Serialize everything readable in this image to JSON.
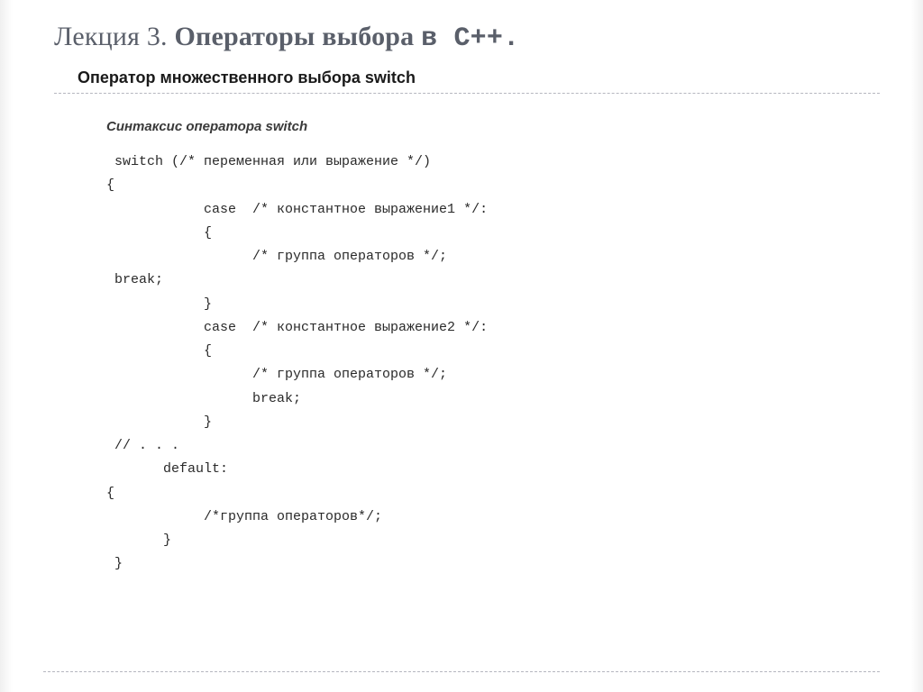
{
  "title": {
    "prefix": "Лекция 3. ",
    "bold": "Операторы выбора ",
    "mono": "в С++."
  },
  "subtitle": "Оператор множественного выбора switch",
  "section_head": "Синтаксис оператора switch",
  "code_lines": [
    " switch (/* переменная или выражение */)",
    "{",
    "            case  /* константное выражение1 */:",
    "            {",
    "                  /* группа операторов */;",
    " break;",
    "            }",
    "            case  /* константное выражение2 */:",
    "            {",
    "                  /* группа операторов */;",
    "                  break;",
    "            }",
    " // . . .",
    "       default:",
    "{",
    "            /*группа операторов*/;",
    "       }",
    " }"
  ]
}
